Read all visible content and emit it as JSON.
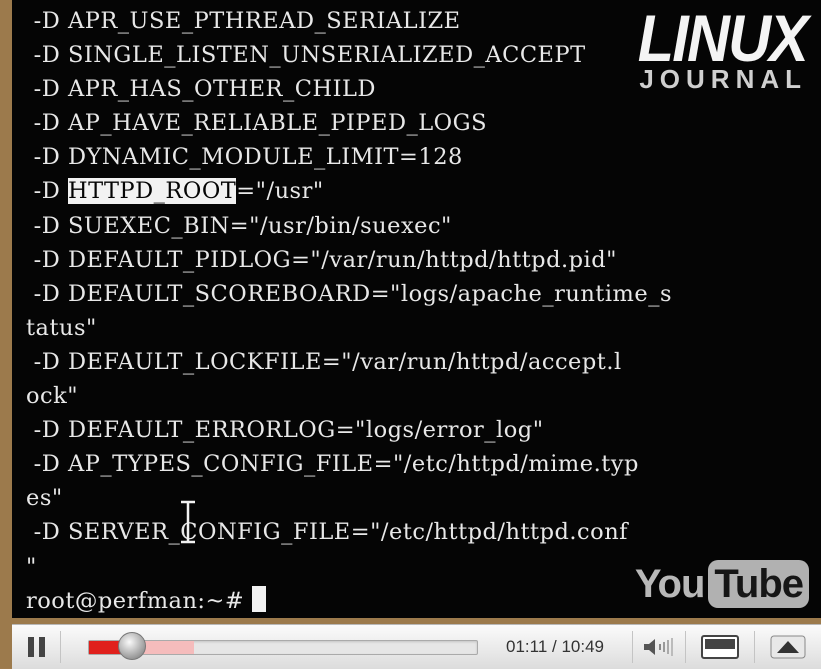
{
  "terminal": {
    "lines": [
      " -D APR_USE_PTHREAD_SERIALIZE",
      " -D SINGLE_LISTEN_UNSERIALIZED_ACCEPT",
      " -D APR_HAS_OTHER_CHILD",
      " -D AP_HAVE_RELIABLE_PIPED_LOGS",
      " -D DYNAMIC_MODULE_LIMIT=128",
      null,
      " -D SUEXEC_BIN=\"/usr/bin/suexec\"",
      " -D DEFAULT_PIDLOG=\"/var/run/httpd/httpd.pid\"",
      " -D DEFAULT_SCOREBOARD=\"logs/apache_runtime_s",
      "tatus\"",
      " -D DEFAULT_LOCKFILE=\"/var/run/httpd/accept.l",
      "ock\"",
      " -D DEFAULT_ERRORLOG=\"logs/error_log\"",
      " -D AP_TYPES_CONFIG_FILE=\"/etc/httpd/mime.typ",
      "es\"",
      " -D SERVER_CONFIG_FILE=\"/etc/httpd/httpd.conf",
      "\"",
      null
    ],
    "highlight_line": {
      "prefix": " -D ",
      "selected": "HTTPD_ROOT",
      "suffix": "=\"/usr\""
    },
    "prompt": "root@perfman:~# "
  },
  "watermarks": {
    "linux": "LINUX",
    "journal": "JOURNAL",
    "you": "You",
    "tube": "Tube"
  },
  "player": {
    "time": "01:11 / 10:49",
    "progress_played": 0.112,
    "progress_buffered": 0.27,
    "accent_color": "#e0201c",
    "icons": {
      "pause": "pause-icon",
      "volume": "volume-icon",
      "screen": "screen-size-icon",
      "expand": "expand-up-icon"
    }
  }
}
